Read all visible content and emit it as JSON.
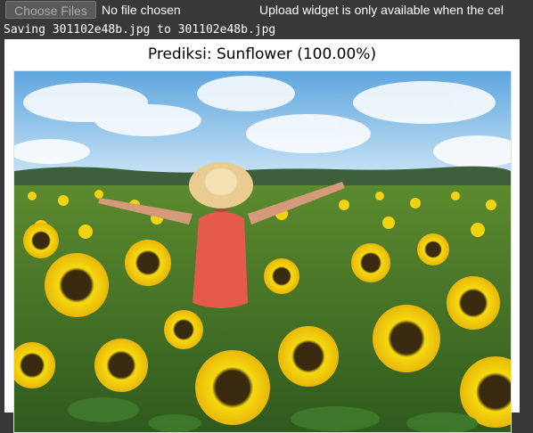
{
  "file_input": {
    "button_label": "Choose Files",
    "status": "No file chosen"
  },
  "notice": "Upload widget is only available when the cel",
  "output": {
    "log_line": "Saving 301102e48b.jpg to 301102e48b.jpg",
    "plot_title": "Prediksi: Sunflower (100.00%)"
  },
  "colors": {
    "page_bg": "#383838",
    "figure_bg": "#ffffff",
    "sky": "#8fc4ea",
    "sunflower": "#f5d80f",
    "foliage": "#3f7a2c"
  }
}
